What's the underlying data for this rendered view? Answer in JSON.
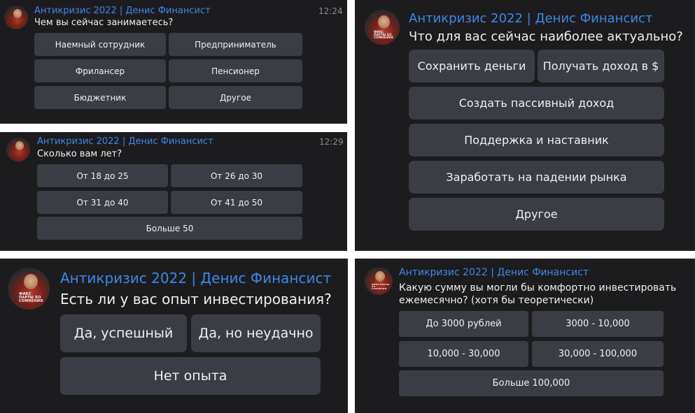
{
  "colors": {
    "panel_bg": "#1c1c1e",
    "button_bg": "#3a3d44",
    "title": "#3e87e8",
    "text": "#f0f0f0",
    "time": "#8e8e93"
  },
  "avatar_text": "ФИКС ПАРТЫ БО СОМНЕНИЯ",
  "panel1": {
    "title": "Антикризис 2022 | Денис Финансист",
    "question": "Чем вы сейчас занимаетесь?",
    "time": "12:24",
    "buttons": [
      "Наемный сотрудник",
      "Предприниматель",
      "Фрилансер",
      "Пенсионер",
      "Бюджетник",
      "Другое"
    ]
  },
  "panel2": {
    "title": "Антикризис 2022 | Денис Финансист",
    "question": "Сколько вам лет?",
    "time": "12:29",
    "buttons": [
      "От 18 до 25",
      "От 26 до 30",
      "От 31 до 40",
      "От 41 до 50",
      "Больше 50"
    ]
  },
  "panel3": {
    "title": "Антикризис 2022 | Денис Финансист",
    "question": "Что для вас сейчас наиболее актуально?",
    "buttons": [
      "Сохранить деньги",
      "Получать доход в $",
      "Создать пассивный доход",
      "Поддержка и наставник",
      "Заработать на падении рынка",
      "Другое"
    ]
  },
  "panel4": {
    "title": "Антикризис 2022 | Денис Финансист",
    "question": "Есть ли у вас опыт инвестирования?",
    "buttons": [
      "Да, успешный",
      "Да, но неудачно",
      "Нет опыта"
    ]
  },
  "panel5": {
    "title": "Антикризис 2022 | Денис Финансист",
    "question": "Какую сумму вы могли бы комфортно инвестировать ежемесячно? (хотя бы теоретически)",
    "buttons": [
      "До 3000 рублей",
      "3000 - 10,000",
      "10,000 - 30,000",
      "30,000 - 100,000",
      "Больше 100,000"
    ]
  }
}
